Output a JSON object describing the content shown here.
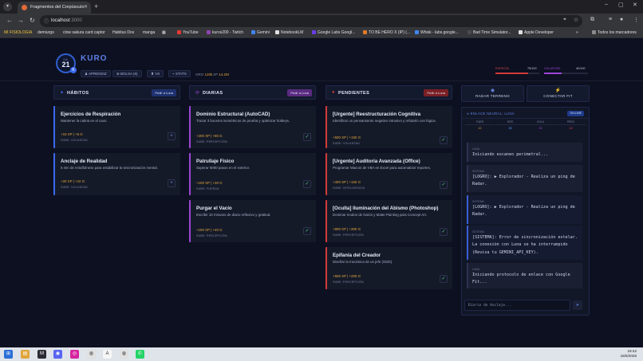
{
  "browser": {
    "tab_title": "Fragmentos del Crepúsculo",
    "url_host": "localhost",
    "url_port": ":3000",
    "bookmarks": [
      {
        "label": "MI FISIOLOGIA",
        "color": "#f0c33c"
      },
      {
        "label": "demiurgo",
        "color": "#4a4a52"
      },
      {
        "label": "clow sakura card captor",
        "color": "#4a4a52"
      },
      {
        "label": "Habitus Dov",
        "color": "#4a4a52"
      },
      {
        "label": "manga",
        "color": "#4a4a52"
      },
      {
        "label": "YouTube",
        "color": "#e53935"
      },
      {
        "label": "kuros200 - Twitch",
        "color": "#8e44ad"
      },
      {
        "label": "Gemini",
        "color": "#4285f4"
      },
      {
        "label": "NotebookLM",
        "color": "#e0e0e0"
      },
      {
        "label": "Google Labs Googl...",
        "color": "#6a3de8"
      },
      {
        "label": "TO BE HERO X (IP) (...",
        "color": "#e07b2a"
      },
      {
        "label": "Whisk - labs.google...",
        "color": "#4285f4"
      },
      {
        "label": "Bad Time Simulator...",
        "color": "#4a4a52"
      },
      {
        "label": "Apple Developer",
        "color": "#e0e0e0"
      }
    ],
    "all_bookmarks": "Todos los marcadores"
  },
  "header": {
    "level_label": "LVL",
    "level": "21",
    "level_badge": "K",
    "player_name": "KURO",
    "buttons": [
      "APRENDIZ",
      "BOLSA (6)",
      "VS",
      "STATS"
    ],
    "gold_label": "ORO",
    "gold_value": "120k",
    "xp_label": "XP",
    "xp_value": "14.2M",
    "energy_label": "ENERGÍA",
    "energy_value": "75/100",
    "energy_fraction": 0.75,
    "energy_color": "#d33a3a",
    "will_label": "VOLUNTAD",
    "will_value": "40/100",
    "will_fraction": 0.4,
    "will_color": "#9b45d8"
  },
  "columns": {
    "habitos": {
      "title": "HÁBITOS",
      "icon": "sparkle-icon",
      "button": "Pedir a Luna",
      "accent": "#3a6af0",
      "cards": [
        {
          "title": "Ejercicios de Respiración",
          "desc": "Mantener la calma en el caos.",
          "reward": "+10 XP | +5 G",
          "sub": "SUBE: VOLUNTAD",
          "action": "+"
        },
        {
          "title": "Anclaje de Realidad",
          "desc": "5 min de mindfulness para estabilizar la sincronización mental.",
          "reward": "+20 XP | +10 G",
          "sub": "SUBE: VOLUNTAD",
          "action": "+"
        }
      ]
    },
    "diarias": {
      "title": "DIARIAS",
      "icon": "repeat-icon",
      "button": "Pedir a Luna",
      "accent": "#9b45d8",
      "cards": [
        {
          "title": "Dominio Estructural (AutoCAD)",
          "desc": "Trazar 3 bocetos isométricos de prueba y optimizar hotkeys.",
          "reward": "+200 XP | +80 G",
          "sub": "SUBE: PERCEPCIÓN",
          "action": "✓"
        },
        {
          "title": "Patrullaje Físico",
          "desc": "Superar 6000 pasos en el exterior.",
          "reward": "+100 XP | +30 G",
          "sub": "SUBE: FUERZA",
          "action": "✓"
        },
        {
          "title": "Purgar el Vacío",
          "desc": "Escribir 10 minutos de diario reflexivo y gratitud.",
          "reward": "+150 XP | +40 G",
          "sub": "SUBE: PERCEPCIÓN",
          "action": "✓"
        }
      ]
    },
    "pendientes": {
      "title": "PENDIENTES",
      "icon": "alert-icon",
      "button": "Pedir a Luna",
      "accent": "#d33a3a",
      "cards": [
        {
          "title": "[Urgente] Reestructuración Cognitiva",
          "desc": "Identificar un pensamiento negativo intrusivo y refutarlo con lógica.",
          "reward": "+500 XP | +150 G",
          "sub": "SUBE: VOLUNTAD",
          "action": "✓"
        },
        {
          "title": "[Urgente] Auditoría Avanzada (Office)",
          "desc": "Programar Macros de VBA en Excel para automatizar reportes.",
          "reward": "+400 XP | +150 G",
          "sub": "SUBE: INTELIGENCIA",
          "action": "✓"
        },
        {
          "title": "[Oculta] Iluminación del Abismo (Photoshop)",
          "desc": "Dominar modos de fusión y Matte Painting para Concept Art.",
          "reward": "+800 XP | +300 G",
          "sub": "SUBE: PERCEPCIÓN",
          "action": "✓"
        },
        {
          "title": "Epifanía del Creador",
          "desc": "Diseñar la mecánica de un jefe (GDD).",
          "reward": "+500 XP | +200 G",
          "sub": "SUBE: PERCEPCIÓN",
          "action": "✓"
        }
      ]
    }
  },
  "side": {
    "radar_label": "RADAR TERRENO",
    "connect_label": "CONECTAR FIT",
    "terminal_title": "ENLACE NEURAL: LUNA",
    "terminal_status": "ON-LINE",
    "meters": [
      {
        "label": "FUER",
        "value": "12",
        "color": "#e0a63a"
      },
      {
        "label": "INTE",
        "value": "28",
        "color": "#4aa0ff"
      },
      {
        "label": "VOLU",
        "value": "15",
        "color": "#9b45d8"
      },
      {
        "label": "PERC",
        "value": "18",
        "color": "#d33a3a"
      }
    ],
    "logs": [
      {
        "tag": "LUNA",
        "text": "Iniciando escaneo perimetral...",
        "accent": false
      },
      {
        "tag": "SISTEMA",
        "text": "[LOGRO]: ▶ Explorador - Realiza un ping de Radar.",
        "accent": false
      },
      {
        "tag": "SISTEMA",
        "text": "[LOGRO]: ▶ Explorador - Realiza un ping de Radar.",
        "accent": true
      },
      {
        "tag": "SISTEMA",
        "text": "[SISTEMA]: Error de sincronización estelar. La conexión con Luna se ha interrumpido (Revisa tu GEMINI_API_KEY).",
        "accent": true
      },
      {
        "tag": "LUNA",
        "text": "Iniciando protocolo de enlace con Google Fit...",
        "accent": false
      }
    ],
    "input_placeholder": "Diario de Anclaje..."
  },
  "taskbar": {
    "time": "19:42",
    "date": "16/5/2026"
  }
}
